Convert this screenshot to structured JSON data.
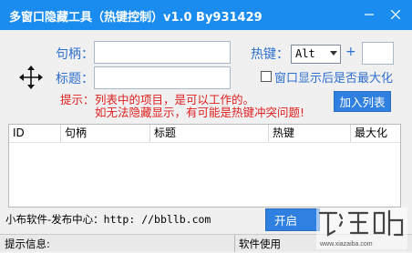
{
  "window": {
    "title": "多窗口隐藏工具（热键控制）v1.0 By931429",
    "minimize_icon": "minimize-icon",
    "close_icon": "close-icon"
  },
  "form": {
    "handle_label": "句柄：",
    "handle_value": "",
    "title_label": "标题：",
    "title_value": "",
    "hotkey_label": "热键：",
    "hotkey_modifier": "Alt",
    "plus": "+",
    "hotkey_key": "",
    "maximize_label": "窗口显示后是否最大化",
    "maximize_checked": false,
    "hint_prefix": "提示：",
    "hint_line1": "列表中的项目，是可以工作的。",
    "hint_line2": "如无法隐藏显示，有可能是热键冲突问题!",
    "add_button": "加入列表",
    "crosshair_icon": "move-crosshair-icon"
  },
  "table": {
    "columns": [
      "ID",
      "句柄",
      "标题",
      "热键",
      "最大化"
    ],
    "rows": []
  },
  "footer": {
    "link_label": "小布软件-发布中心：",
    "link_url": "http: //bbllb.com",
    "start_button": "开启"
  },
  "statusbar": {
    "info_label": "提示信息:",
    "usage_label": "软件使用"
  },
  "watermark": {
    "text": "下载吧"
  },
  "colors": {
    "titlebar": "#1a8cf0",
    "label_blue": "#2f6fd0",
    "hint_red": "#e02020",
    "button_blue": "#2f80e0"
  }
}
